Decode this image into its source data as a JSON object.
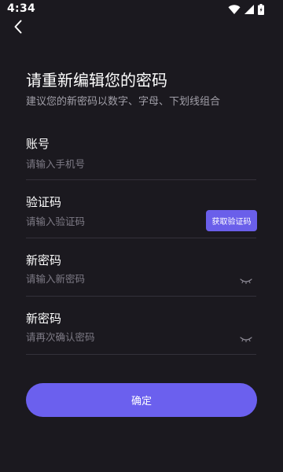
{
  "status_bar": {
    "time": "4:34",
    "icons": [
      "wifi-icon",
      "cellular-icon",
      "battery-icon"
    ]
  },
  "header": {
    "back_icon": "chevron-left-icon",
    "title": "请重新编辑您的密码",
    "subtitle": "建议您的新密码以数字、字母、下划线组合"
  },
  "form": {
    "account": {
      "label": "账号",
      "placeholder": "请输入手机号"
    },
    "code": {
      "label": "验证码",
      "placeholder": "请输入验证码",
      "button_label": "获取验证码"
    },
    "new_password": {
      "label": "新密码",
      "placeholder": "请输入新密码",
      "toggle_icon": "eye-closed-icon"
    },
    "confirm_password": {
      "label": "新密码",
      "placeholder": "请再次确认密码",
      "toggle_icon": "eye-closed-icon"
    }
  },
  "actions": {
    "confirm_label": "确定"
  },
  "colors": {
    "background": "#1b191f",
    "accent": "#6b60ee",
    "divider": "#34313a",
    "placeholder": "#7e7b86",
    "subtitle": "#a19fa8"
  }
}
